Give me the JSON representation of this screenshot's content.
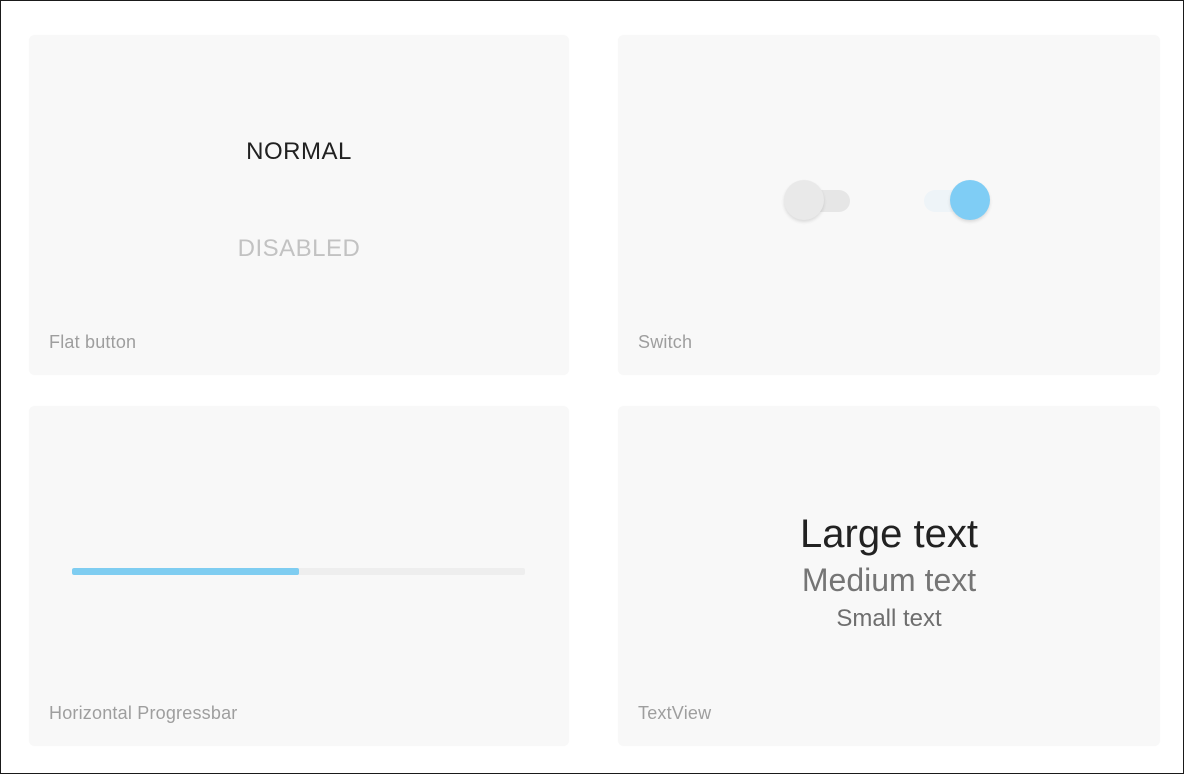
{
  "flat_button": {
    "normal_label": "NORMAL",
    "disabled_label": "DISABLED",
    "caption": "Flat button"
  },
  "switch": {
    "caption": "Switch",
    "off_state": false,
    "on_state": true,
    "accent_color": "#7fcdf5"
  },
  "progress": {
    "caption": "Horizontal Progressbar",
    "value": 0.5,
    "color": "#7fcdf1"
  },
  "textview": {
    "caption": "TextView",
    "large": "Large text",
    "medium": "Medium text",
    "small": "Small text"
  }
}
